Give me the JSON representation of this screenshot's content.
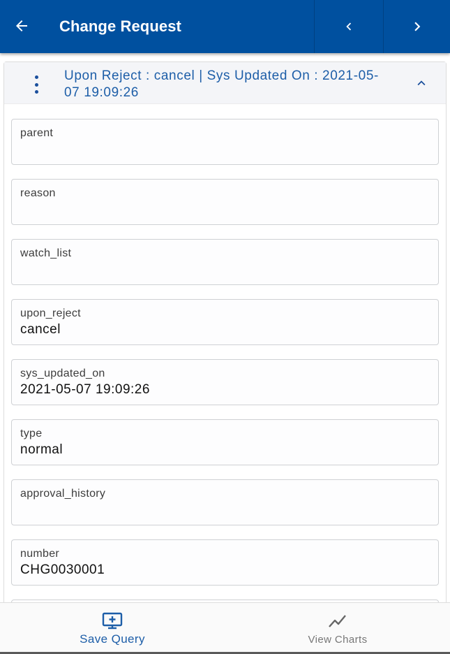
{
  "header": {
    "title": "Change Request",
    "back_icon": "arrow-left-icon",
    "prev_icon": "chevron-left-icon",
    "next_icon": "chevron-right-icon",
    "bg_color": "#00509f"
  },
  "section": {
    "title": "Upon Reject : cancel | Sys Updated On : 2021-05-07 19:09:26",
    "menu_icon": "kebab-menu-icon",
    "collapse_icon": "chevron-up-icon"
  },
  "fields": [
    {
      "label": "parent",
      "value": ""
    },
    {
      "label": "reason",
      "value": ""
    },
    {
      "label": "watch_list",
      "value": ""
    },
    {
      "label": "upon_reject",
      "value": "cancel"
    },
    {
      "label": "sys_updated_on",
      "value": "2021-05-07 19:09:26"
    },
    {
      "label": "type",
      "value": "normal"
    },
    {
      "label": "approval_history",
      "value": ""
    },
    {
      "label": "number",
      "value": "CHG0030001"
    },
    {
      "label": "",
      "value": ""
    }
  ],
  "bottom_bar": {
    "save_query": {
      "label": "Save Query",
      "icon": "monitor-plus-icon"
    },
    "view_charts": {
      "label": "View Charts",
      "icon": "line-chart-icon"
    }
  }
}
